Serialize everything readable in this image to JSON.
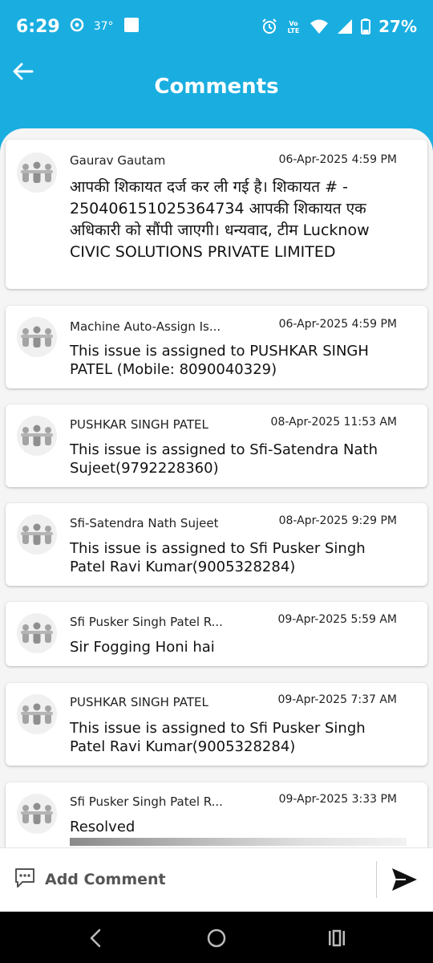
{
  "status_bar": {
    "time": "6:29",
    "temperature": "37°",
    "battery": "27%",
    "network_label": "Vo LTE"
  },
  "header": {
    "title": "Comments",
    "background_color": "#1aaee0"
  },
  "comments": [
    {
      "author": "Gaurav Gautam",
      "date": "06-Apr-2025 4:59 PM",
      "message": "आपकी शिकायत दर्ज कर ली गई है। शिकायत # - 250406151025364734 आपकी शिकायत एक अधिकारी को सौंपी जाएगी। धन्यवाद, टीम Lucknow CIVIC SOLUTIONS PRIVATE LIMITED"
    },
    {
      "author": "Machine Auto-Assign Is...",
      "date": "06-Apr-2025 4:59 PM",
      "message": "This issue is assigned to PUSHKAR SINGH PATEL (Mobile: 8090040329)"
    },
    {
      "author": "PUSHKAR SINGH PATEL",
      "date": "08-Apr-2025 11:53 AM",
      "message": "This issue is assigned to Sfi-Satendra Nath Sujeet(9792228360)"
    },
    {
      "author": "Sfi-Satendra Nath Sujeet",
      "date": "08-Apr-2025 9:29 PM",
      "message": "This issue is assigned to Sfi Pusker Singh Patel Ravi Kumar(9005328284)"
    },
    {
      "author": "Sfi Pusker Singh Patel R...",
      "date": "09-Apr-2025 5:59 AM",
      "message": "Sir Fogging Honi hai"
    },
    {
      "author": "PUSHKAR SINGH PATEL",
      "date": "09-Apr-2025 7:37 AM",
      "message": "This issue is assigned to Sfi Pusker Singh Patel Ravi Kumar(9005328284)"
    },
    {
      "author": "Sfi Pusker Singh Patel R...",
      "date": "09-Apr-2025 3:33 PM",
      "message": "Resolved"
    }
  ],
  "composer": {
    "placeholder": "Add Comment"
  }
}
